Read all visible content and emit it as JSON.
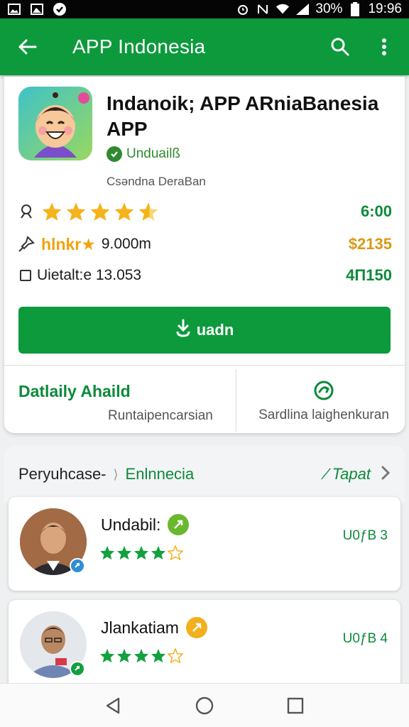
{
  "status_bar": {
    "battery": "30%",
    "time": "19:96"
  },
  "appbar": {
    "title": "APP Indonesia"
  },
  "app": {
    "name": "Indanoik; APP ARniaBanesia APP",
    "developer": "Unduailß",
    "subtitle": "Csəndna DeraBan",
    "rating_value": "6:00",
    "downloads_label": "hlnkr★",
    "downloads_value": "9.000m",
    "downloads_extra": "$2135",
    "installs_label": "Uietalt:e 13.053",
    "installs_extra": "4Π150",
    "install_button": "uadn",
    "details_title": "Datlaily Ahaild",
    "details_sub": "Runtaipencarsian",
    "share_sub": "Sardlina laighenkuran"
  },
  "section": {
    "crumb1": "Peryuhcase-",
    "crumb_sep": "⟩",
    "crumb2": "Enlnnecia",
    "link": "∕ Tapat"
  },
  "reviews": [
    {
      "name": "Undabil:",
      "tag": "U0ƒB 3",
      "rating": 4.5,
      "badge_color": "#6ab82e"
    },
    {
      "name": "Jlankatiam",
      "tag": "U0ƒB 4",
      "rating": 4.5,
      "badge_color": "#f2b01e"
    }
  ],
  "colors": {
    "primary": "#0c9a3c",
    "star": "#f5b21b",
    "review_star": "#13a03e"
  }
}
